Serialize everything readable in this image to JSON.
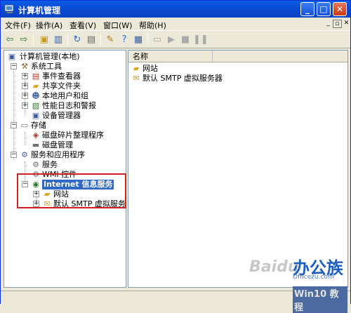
{
  "window": {
    "title": "计算机管理"
  },
  "menu": {
    "file": "文件(F)",
    "action": "操作(A)",
    "view": "查看(V)",
    "window": "窗口(W)",
    "help": "帮助(H)"
  },
  "toolbar": {
    "back_icon": "back-arrow-icon",
    "forward_icon": "forward-arrow-icon"
  },
  "tree": {
    "root": "计算机管理(本地)",
    "system_tools": "系统工具",
    "event_viewer": "事件查看器",
    "shared_folders": "共享文件夹",
    "local_users": "本地用户和组",
    "perf_logs": "性能日志和警报",
    "device_manager": "设备管理器",
    "storage": "存储",
    "defrag": "磁盘碎片整理程序",
    "disk_mgmt": "磁盘管理",
    "services_apps": "服务和应用程序",
    "services": "服务",
    "wmi": "WMI 控件",
    "iis": "Internet 信息服务",
    "websites": "网站",
    "smtp": "默认 SMTP 虚拟服务器"
  },
  "list": {
    "column_name": "名称",
    "items": [
      "网站",
      "默认 SMTP 虚拟服务器"
    ]
  },
  "watermark": {
    "baidu": "Baidu",
    "office": "办公族",
    "site": "Officezu.com",
    "win": "Win10 教程"
  },
  "colors": {
    "title_bar": "#0b4bd4",
    "selection": "#316ac5",
    "highlight_box": "#d42222"
  }
}
